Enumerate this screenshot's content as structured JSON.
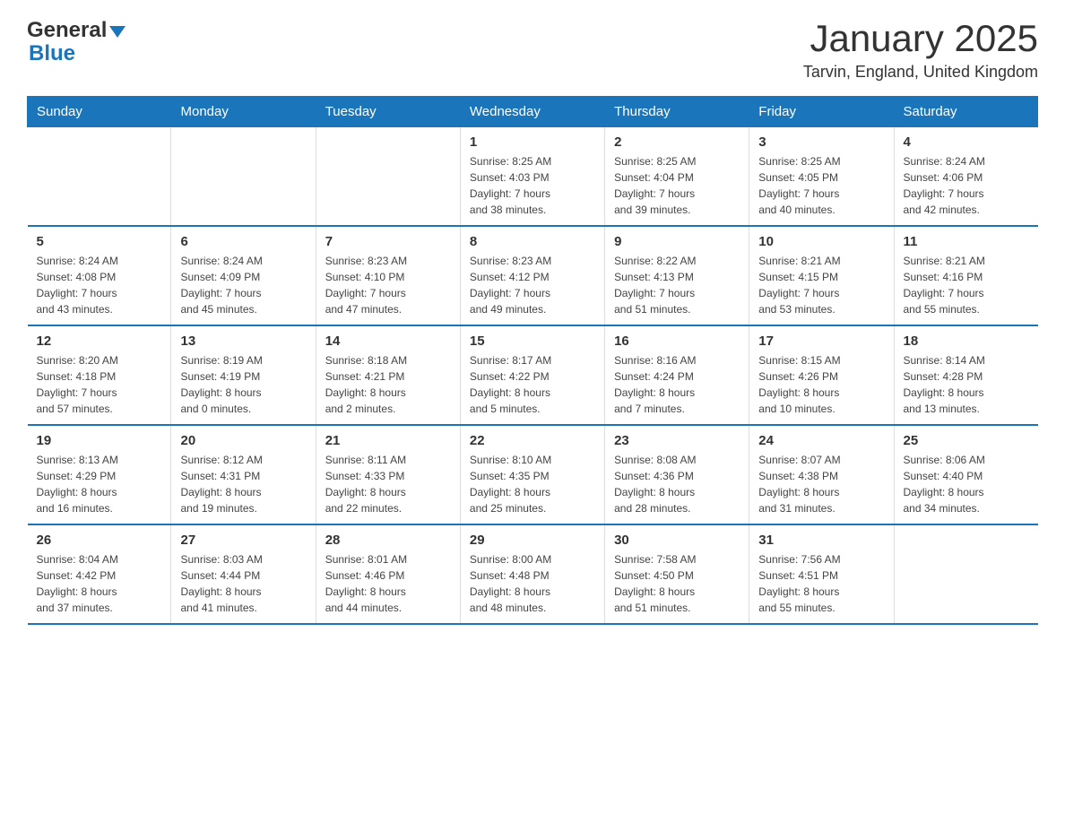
{
  "header": {
    "logo_general": "General",
    "logo_blue": "Blue",
    "month_title": "January 2025",
    "location": "Tarvin, England, United Kingdom"
  },
  "days_of_week": [
    "Sunday",
    "Monday",
    "Tuesday",
    "Wednesday",
    "Thursday",
    "Friday",
    "Saturday"
  ],
  "weeks": [
    [
      {
        "day": "",
        "info": ""
      },
      {
        "day": "",
        "info": ""
      },
      {
        "day": "",
        "info": ""
      },
      {
        "day": "1",
        "info": "Sunrise: 8:25 AM\nSunset: 4:03 PM\nDaylight: 7 hours\nand 38 minutes."
      },
      {
        "day": "2",
        "info": "Sunrise: 8:25 AM\nSunset: 4:04 PM\nDaylight: 7 hours\nand 39 minutes."
      },
      {
        "day": "3",
        "info": "Sunrise: 8:25 AM\nSunset: 4:05 PM\nDaylight: 7 hours\nand 40 minutes."
      },
      {
        "day": "4",
        "info": "Sunrise: 8:24 AM\nSunset: 4:06 PM\nDaylight: 7 hours\nand 42 minutes."
      }
    ],
    [
      {
        "day": "5",
        "info": "Sunrise: 8:24 AM\nSunset: 4:08 PM\nDaylight: 7 hours\nand 43 minutes."
      },
      {
        "day": "6",
        "info": "Sunrise: 8:24 AM\nSunset: 4:09 PM\nDaylight: 7 hours\nand 45 minutes."
      },
      {
        "day": "7",
        "info": "Sunrise: 8:23 AM\nSunset: 4:10 PM\nDaylight: 7 hours\nand 47 minutes."
      },
      {
        "day": "8",
        "info": "Sunrise: 8:23 AM\nSunset: 4:12 PM\nDaylight: 7 hours\nand 49 minutes."
      },
      {
        "day": "9",
        "info": "Sunrise: 8:22 AM\nSunset: 4:13 PM\nDaylight: 7 hours\nand 51 minutes."
      },
      {
        "day": "10",
        "info": "Sunrise: 8:21 AM\nSunset: 4:15 PM\nDaylight: 7 hours\nand 53 minutes."
      },
      {
        "day": "11",
        "info": "Sunrise: 8:21 AM\nSunset: 4:16 PM\nDaylight: 7 hours\nand 55 minutes."
      }
    ],
    [
      {
        "day": "12",
        "info": "Sunrise: 8:20 AM\nSunset: 4:18 PM\nDaylight: 7 hours\nand 57 minutes."
      },
      {
        "day": "13",
        "info": "Sunrise: 8:19 AM\nSunset: 4:19 PM\nDaylight: 8 hours\nand 0 minutes."
      },
      {
        "day": "14",
        "info": "Sunrise: 8:18 AM\nSunset: 4:21 PM\nDaylight: 8 hours\nand 2 minutes."
      },
      {
        "day": "15",
        "info": "Sunrise: 8:17 AM\nSunset: 4:22 PM\nDaylight: 8 hours\nand 5 minutes."
      },
      {
        "day": "16",
        "info": "Sunrise: 8:16 AM\nSunset: 4:24 PM\nDaylight: 8 hours\nand 7 minutes."
      },
      {
        "day": "17",
        "info": "Sunrise: 8:15 AM\nSunset: 4:26 PM\nDaylight: 8 hours\nand 10 minutes."
      },
      {
        "day": "18",
        "info": "Sunrise: 8:14 AM\nSunset: 4:28 PM\nDaylight: 8 hours\nand 13 minutes."
      }
    ],
    [
      {
        "day": "19",
        "info": "Sunrise: 8:13 AM\nSunset: 4:29 PM\nDaylight: 8 hours\nand 16 minutes."
      },
      {
        "day": "20",
        "info": "Sunrise: 8:12 AM\nSunset: 4:31 PM\nDaylight: 8 hours\nand 19 minutes."
      },
      {
        "day": "21",
        "info": "Sunrise: 8:11 AM\nSunset: 4:33 PM\nDaylight: 8 hours\nand 22 minutes."
      },
      {
        "day": "22",
        "info": "Sunrise: 8:10 AM\nSunset: 4:35 PM\nDaylight: 8 hours\nand 25 minutes."
      },
      {
        "day": "23",
        "info": "Sunrise: 8:08 AM\nSunset: 4:36 PM\nDaylight: 8 hours\nand 28 minutes."
      },
      {
        "day": "24",
        "info": "Sunrise: 8:07 AM\nSunset: 4:38 PM\nDaylight: 8 hours\nand 31 minutes."
      },
      {
        "day": "25",
        "info": "Sunrise: 8:06 AM\nSunset: 4:40 PM\nDaylight: 8 hours\nand 34 minutes."
      }
    ],
    [
      {
        "day": "26",
        "info": "Sunrise: 8:04 AM\nSunset: 4:42 PM\nDaylight: 8 hours\nand 37 minutes."
      },
      {
        "day": "27",
        "info": "Sunrise: 8:03 AM\nSunset: 4:44 PM\nDaylight: 8 hours\nand 41 minutes."
      },
      {
        "day": "28",
        "info": "Sunrise: 8:01 AM\nSunset: 4:46 PM\nDaylight: 8 hours\nand 44 minutes."
      },
      {
        "day": "29",
        "info": "Sunrise: 8:00 AM\nSunset: 4:48 PM\nDaylight: 8 hours\nand 48 minutes."
      },
      {
        "day": "30",
        "info": "Sunrise: 7:58 AM\nSunset: 4:50 PM\nDaylight: 8 hours\nand 51 minutes."
      },
      {
        "day": "31",
        "info": "Sunrise: 7:56 AM\nSunset: 4:51 PM\nDaylight: 8 hours\nand 55 minutes."
      },
      {
        "day": "",
        "info": ""
      }
    ]
  ]
}
